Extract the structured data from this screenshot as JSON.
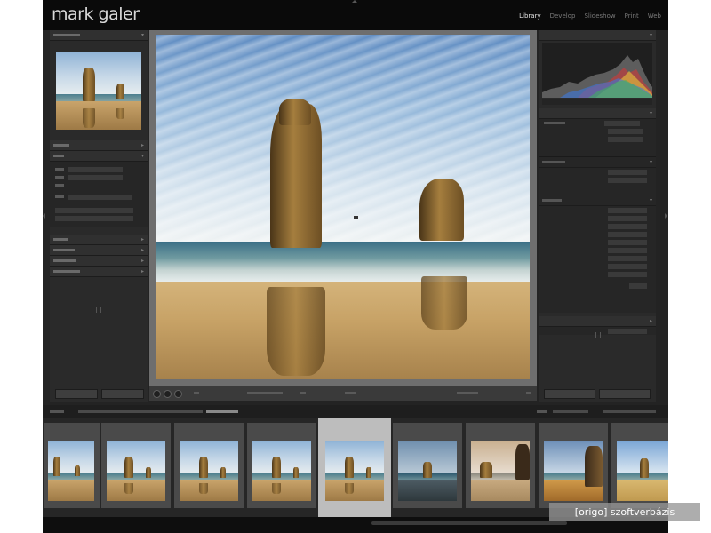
{
  "app": {
    "brand": "mark galer",
    "modules": [
      {
        "label": "Library",
        "active": true
      },
      {
        "label": "Develop",
        "active": false
      },
      {
        "label": "Slideshow",
        "active": false
      },
      {
        "label": "Print",
        "active": false
      },
      {
        "label": "Web",
        "active": false
      }
    ]
  },
  "watermark": {
    "text": "[origo] szoftverbázis"
  },
  "colors": {
    "app_background": "#232323",
    "top_bar": "#0a0a0a",
    "panel": "#2a2a2a",
    "selected_thumb": "#bdbdbd",
    "watermark_bg": "#969696"
  },
  "icons": [
    "chevron-up-icon",
    "chevron-down-icon",
    "chevron-left-icon",
    "chevron-right-icon",
    "grid-view-icon",
    "loupe-view-icon",
    "compare-view-icon"
  ],
  "filmstrip": {
    "thumb_count": 9,
    "selected_index": 4
  }
}
